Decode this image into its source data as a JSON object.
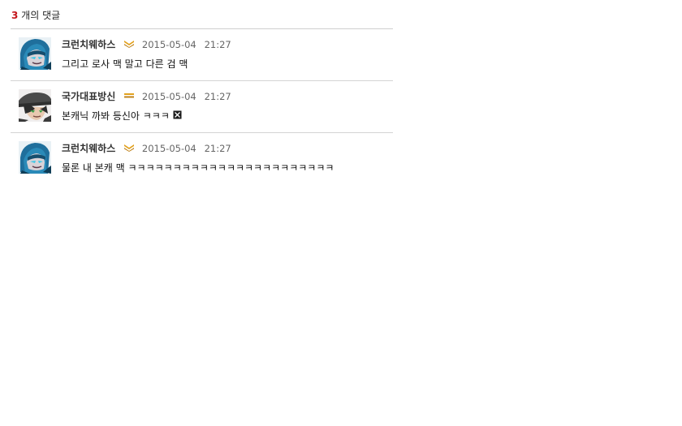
{
  "comments_section": {
    "count": "3",
    "count_suffix": " 개의 댓글",
    "comments": [
      {
        "nickname": "크런치웨하스",
        "rank_icon": "chevron-rank-icon",
        "date": "2015-05-04",
        "time": "21:27",
        "text": "그리고 로사 맥 말고 다른 검 맥",
        "avatar": "hooded-character-avatar"
      },
      {
        "nickname": "국가대표방신",
        "rank_icon": "bars-rank-icon",
        "date": "2015-05-04",
        "time": "21:27",
        "text": "본캐닉 까봐 등신아 ㅋㅋㅋ",
        "emoticon": "x-box-emoticon",
        "avatar": "hatted-character-avatar"
      },
      {
        "nickname": "크런치웨하스",
        "rank_icon": "chevron-rank-icon",
        "date": "2015-05-04",
        "time": "21:27",
        "text": "물론 내 본캐 맥 ㅋㅋㅋㅋㅋㅋㅋㅋㅋㅋㅋㅋㅋㅋㅋㅋㅋㅋㅋㅋㅋㅋㅋ",
        "avatar": "hooded-character-avatar"
      }
    ]
  },
  "colors": {
    "count_red": "#c4161c",
    "divider": "#d4d4d4",
    "rank_gold": "#e0a020"
  }
}
